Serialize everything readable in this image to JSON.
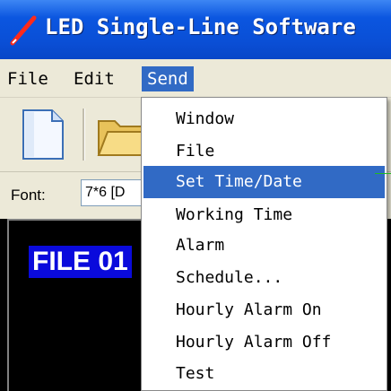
{
  "window": {
    "title": "LED Single-Line Software",
    "icon": "pencil-icon"
  },
  "menubar": {
    "items": [
      {
        "label": "File"
      },
      {
        "label": "Edit"
      },
      {
        "label": "Send",
        "active": true
      }
    ]
  },
  "toolbar": {
    "buttons": [
      {
        "icon": "new-document-icon"
      },
      {
        "icon": "open-folder-icon"
      }
    ]
  },
  "font_row": {
    "label": "Font:",
    "value": "7*6 [D"
  },
  "display": {
    "text": "FILE 01"
  },
  "send_menu": {
    "items": [
      {
        "label": "Window"
      },
      {
        "label": "File"
      },
      {
        "label": "Set Time/Date",
        "highlighted": true
      },
      {
        "label": "Working Time"
      },
      {
        "label": "Alarm"
      },
      {
        "label": "Schedule..."
      },
      {
        "label": "Hourly Alarm On"
      },
      {
        "label": "Hourly Alarm Off"
      },
      {
        "label": "Test"
      }
    ]
  },
  "colors": {
    "titlebar": "#0a4fd6",
    "highlight": "#316ac5",
    "display_bg": "#000000",
    "display_text_bg": "#0a0adc"
  }
}
